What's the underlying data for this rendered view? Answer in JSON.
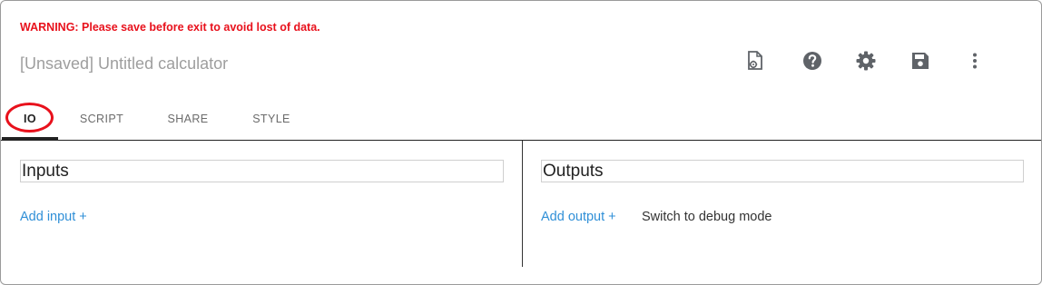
{
  "header": {
    "warning": "WARNING: Please save before exit to avoid lost of data.",
    "title": "[Unsaved] Untitled calculator"
  },
  "toolbar": {
    "icons": [
      "script-file-icon",
      "help-icon",
      "settings-icon",
      "save-icon",
      "more-vert-icon"
    ]
  },
  "tabs": [
    {
      "label": "IO",
      "active": true
    },
    {
      "label": "SCRIPT",
      "active": false
    },
    {
      "label": "SHARE",
      "active": false
    },
    {
      "label": "STYLE",
      "active": false
    }
  ],
  "inputs": {
    "title": "Inputs",
    "add_label": "Add input +"
  },
  "outputs": {
    "title": "Outputs",
    "add_label": "Add output +",
    "debug_label": "Switch to debug mode"
  },
  "colors": {
    "warning": "#e8111c",
    "link": "#2f8fd7",
    "icon": "#5f6368",
    "highlight_circle": "#e8111c"
  }
}
